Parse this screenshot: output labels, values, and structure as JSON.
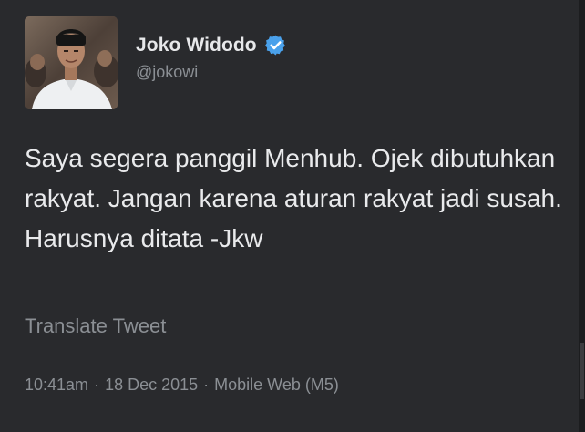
{
  "colors": {
    "background": "#292a2d",
    "name_text": "#e7e8ea",
    "body_text": "#e9eaec",
    "secondary_text": "#8b8f94",
    "verified_badge": "#4aa1eb"
  },
  "author": {
    "display_name": "Joko Widodo",
    "handle": "@jokowi",
    "verified": true,
    "verified_icon": "verified-badge-icon"
  },
  "tweet": {
    "text": "Saya segera panggil Menhub. Ojek dibutuhkan rakyat. Jangan karena aturan rakyat jadi susah. Harusnya ditata -Jkw",
    "translate_label": "Translate Tweet",
    "time": "10:41am",
    "date": "18 Dec 2015",
    "separator": "·",
    "source": "Mobile Web (M5)"
  }
}
